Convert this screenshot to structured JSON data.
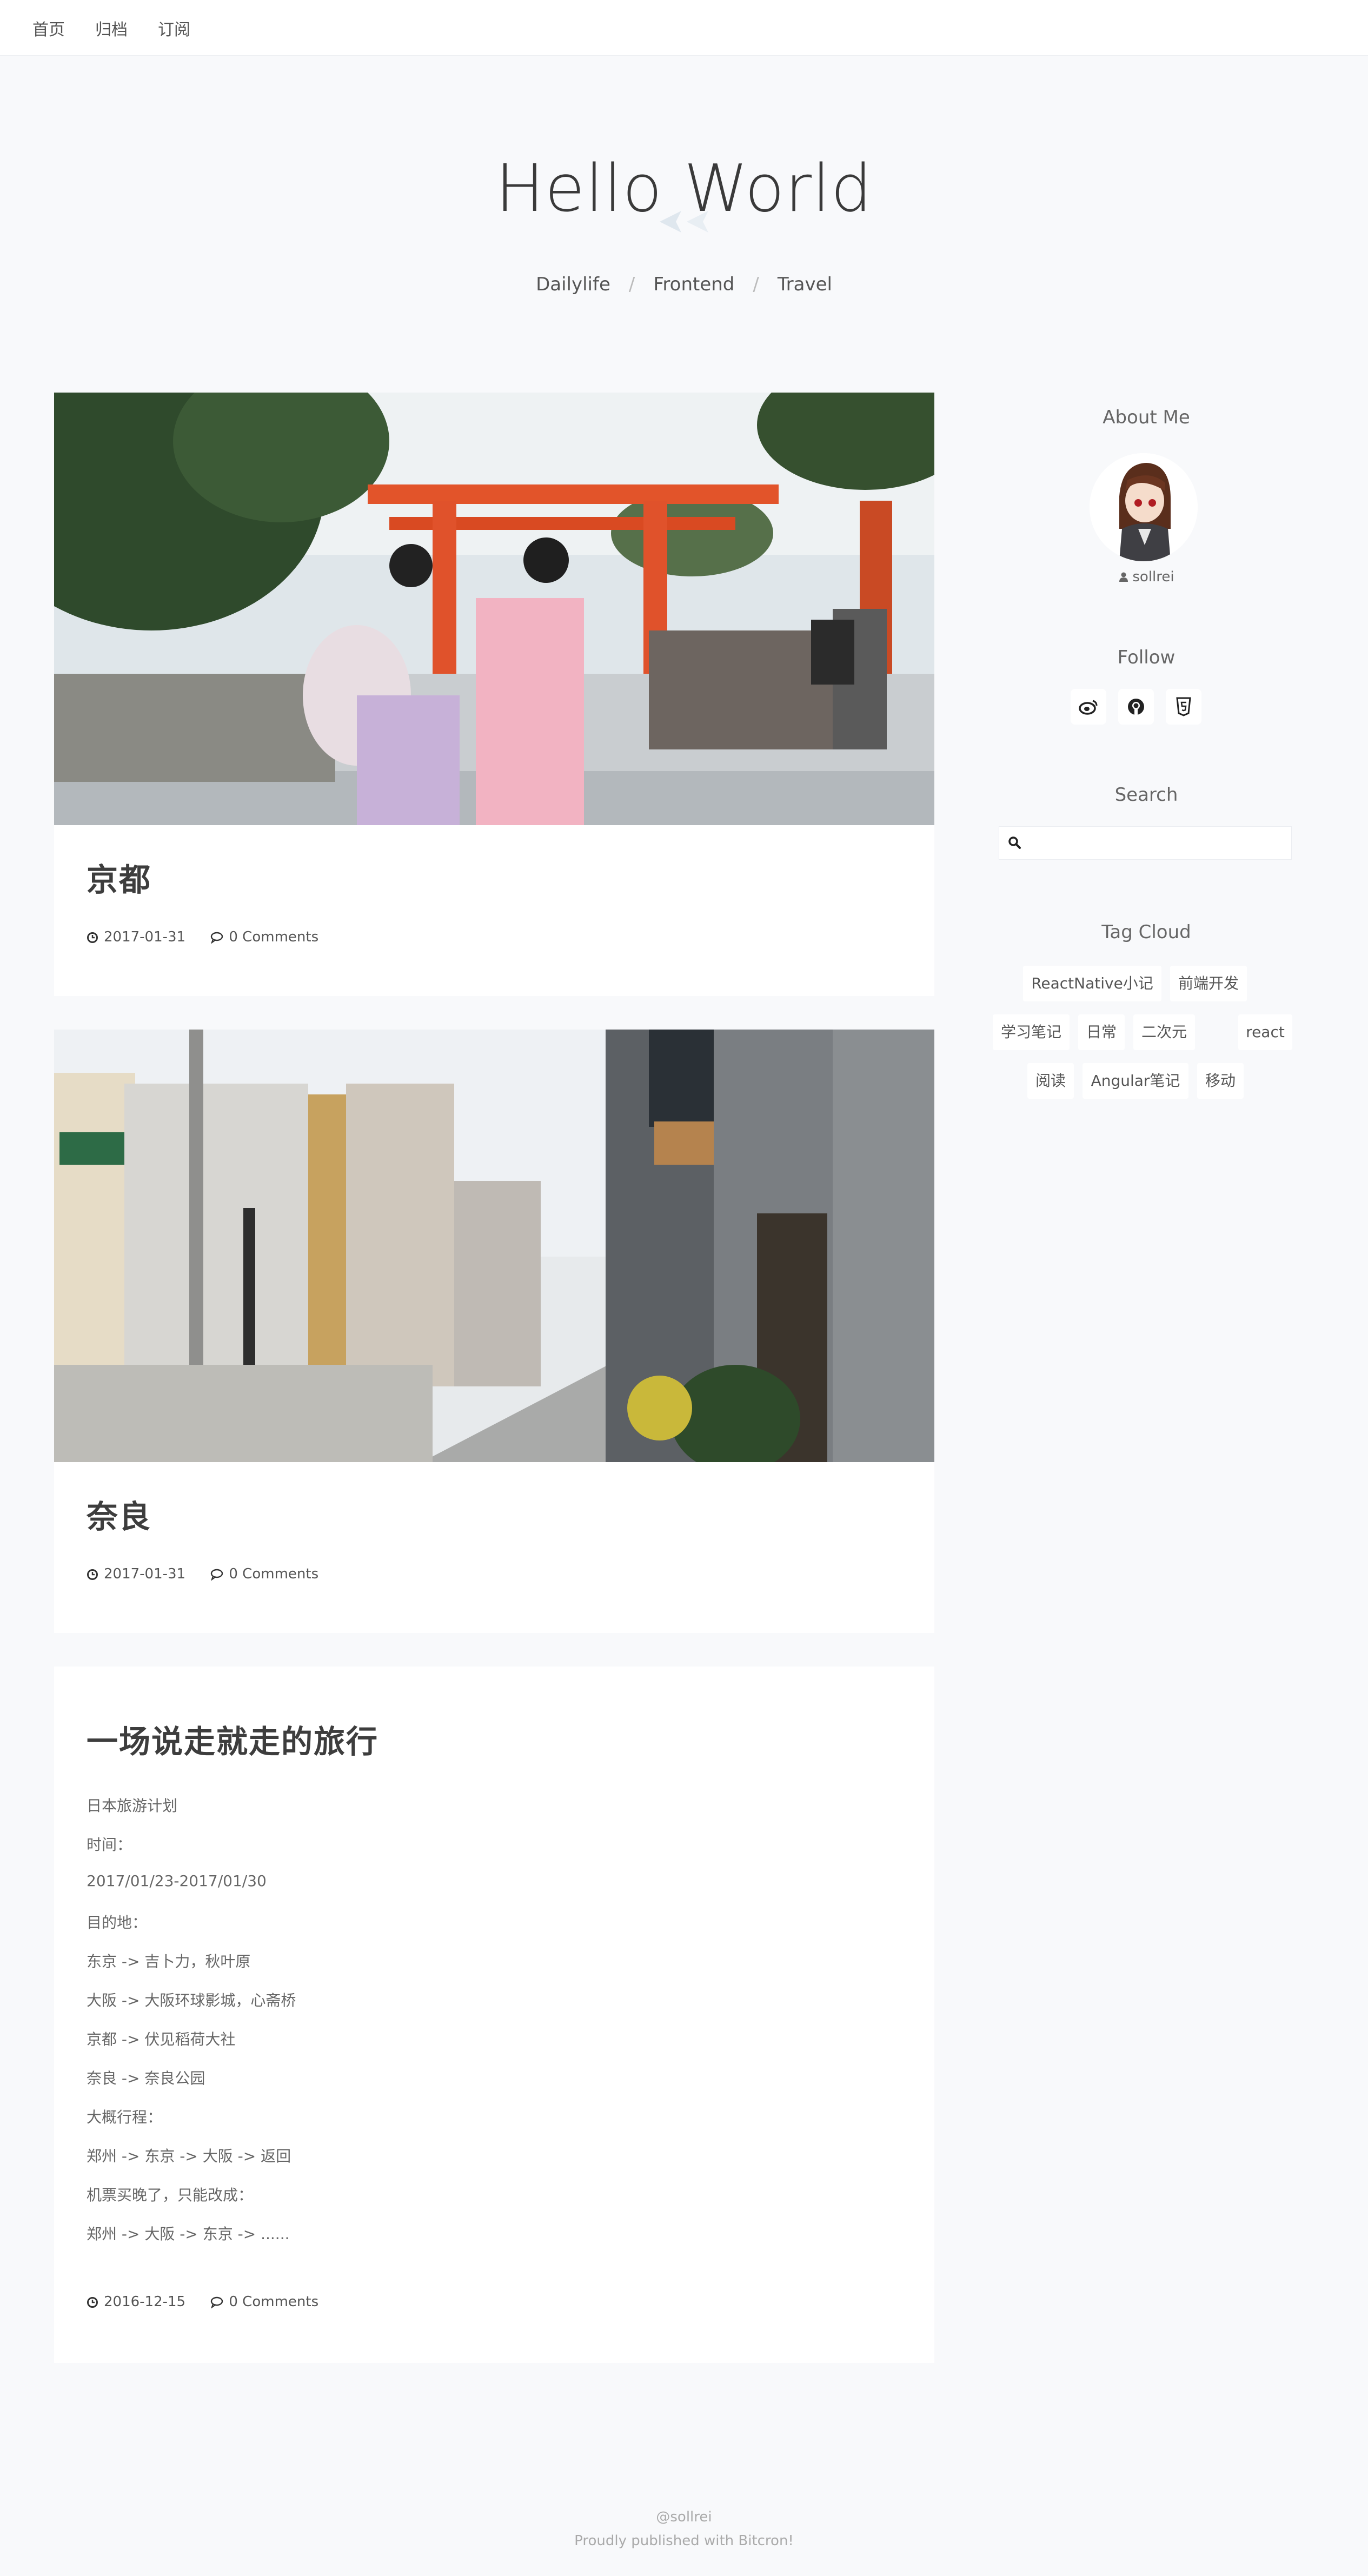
{
  "topnav": {
    "items": [
      "首页",
      "归档",
      "订阅"
    ]
  },
  "header": {
    "title": "Hello World",
    "categories": [
      "Dailylife",
      "Frontend",
      "Travel"
    ]
  },
  "posts": [
    {
      "title": "京都",
      "date": "2017-01-31",
      "comments": "0 Comments"
    },
    {
      "title": "奈良",
      "date": "2017-01-31",
      "comments": "0 Comments"
    },
    {
      "title": "一场说走就走的旅行",
      "body": [
        "日本旅游计划",
        "时间：",
        "2017/01/23-2017/01/30",
        "目的地：",
        "东京 -> 吉卜力，秋叶原",
        "大阪 -> 大阪环球影城，心斋桥",
        "京都 -> 伏见稻荷大社",
        "奈良 -> 奈良公园",
        "大概行程：",
        "郑州 -> 东京 -> 大阪 -> 返回",
        "机票买晚了，只能改成：",
        "郑州 -> 大阪 -> 东京 -> ......"
      ],
      "date": "2016-12-15",
      "comments": "0 Comments"
    }
  ],
  "sidebar": {
    "about_title": "About Me",
    "author": "sollrei",
    "follow_title": "Follow",
    "follow_icons": [
      "weibo-icon",
      "github-icon",
      "html5-icon"
    ],
    "search_title": "Search",
    "search_placeholder": "",
    "tagcloud_title": "Tag Cloud",
    "tags": [
      "ReactNative小记",
      "前端开发",
      "学习笔记",
      "日常",
      "二次元",
      "react",
      "阅读",
      "Angular笔记",
      "移动"
    ]
  },
  "footer": {
    "line1": "@sollrei",
    "line2": "Proudly published with Bitcron!"
  },
  "colors": {
    "background": "#f8f9fb",
    "card": "#ffffff",
    "torii": "#e2542a"
  }
}
